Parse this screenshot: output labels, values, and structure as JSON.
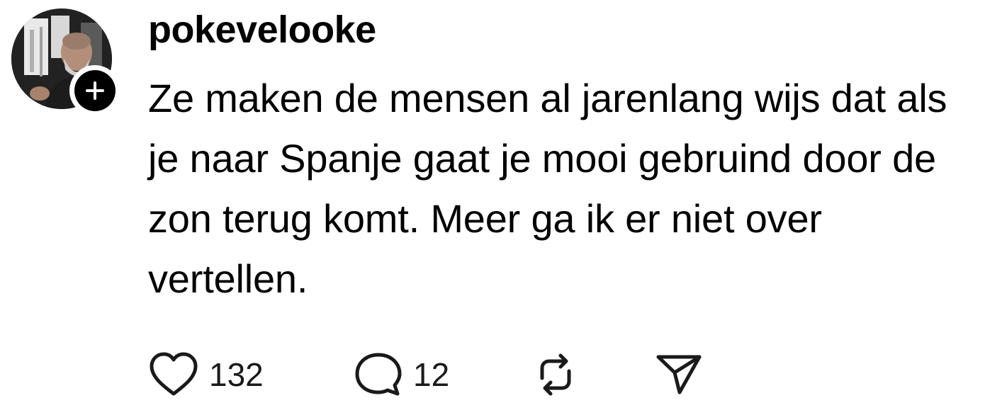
{
  "post": {
    "username": "pokevelooke",
    "text": "Ze maken de mensen al jarenlang wijs dat als je naar Spanje gaat je mooi gebruind door de zon terug komt. Meer ga ik er niet over vertellen.",
    "likes": "132",
    "replies": "12"
  },
  "icons": {
    "follow": "plus-icon",
    "like": "heart-icon",
    "reply": "speech-bubble-icon",
    "repost": "repost-icon",
    "share": "send-icon"
  },
  "colors": {
    "text": "#000000",
    "background": "#ffffff",
    "icon": "#1a1a1a"
  }
}
